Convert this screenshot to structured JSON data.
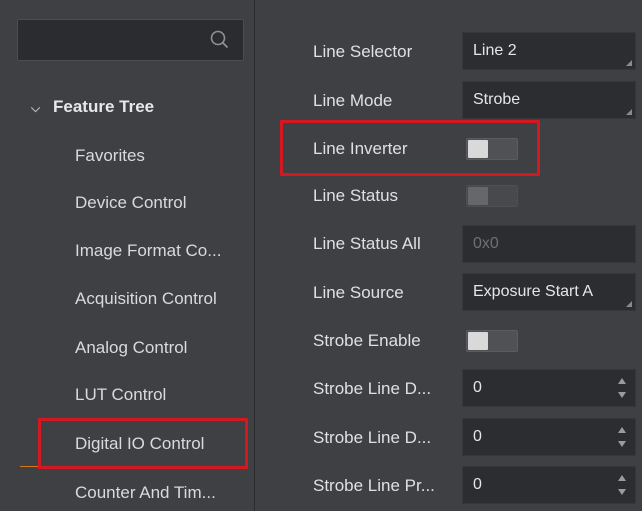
{
  "sidebar": {
    "search": {
      "placeholder": ""
    },
    "tree_title": "Feature Tree",
    "items": [
      {
        "label": "Favorites"
      },
      {
        "label": "Device Control"
      },
      {
        "label": "Image Format Co..."
      },
      {
        "label": "Acquisition Control"
      },
      {
        "label": "Analog Control"
      },
      {
        "label": "LUT Control"
      },
      {
        "label": "Digital IO Control",
        "selected": true
      },
      {
        "label": "Counter And Tim..."
      }
    ]
  },
  "properties": {
    "line_selector": {
      "label": "Line Selector",
      "value": "Line 2"
    },
    "line_mode": {
      "label": "Line Mode",
      "value": "Strobe"
    },
    "line_inverter": {
      "label": "Line Inverter",
      "checked": false
    },
    "line_status": {
      "label": "Line Status",
      "checked": false,
      "enabled": false
    },
    "line_status_all": {
      "label": "Line Status All",
      "value": "0x0"
    },
    "line_source": {
      "label": "Line Source",
      "value": "Exposure Start A"
    },
    "strobe_enable": {
      "label": "Strobe Enable",
      "checked": false
    },
    "strobe_line_duration": {
      "label": "Strobe Line D...",
      "value": "0"
    },
    "strobe_line_delay": {
      "label": "Strobe Line D...",
      "value": "0"
    },
    "strobe_line_pre_delay": {
      "label": "Strobe Line Pr...",
      "value": "0"
    }
  },
  "colors": {
    "highlight_box": "#d4181f",
    "panel_bg": "#3f4044",
    "field_bg": "#2c2d31",
    "selection_accent": "#d8741a"
  }
}
